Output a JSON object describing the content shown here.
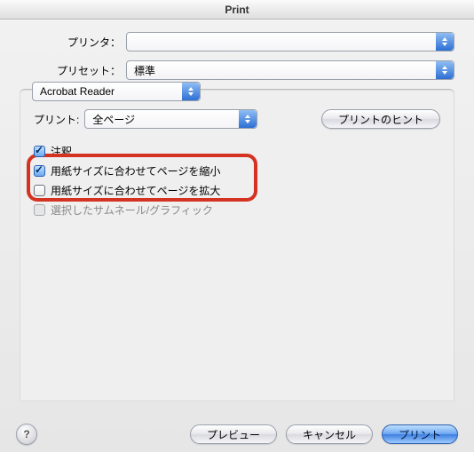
{
  "window": {
    "title": "Print"
  },
  "header": {
    "printer_label": "プリンタ：",
    "printer_value": "",
    "preset_label": "プリセット：",
    "preset_value": "標準"
  },
  "section_tab": "Acrobat Reader",
  "section": {
    "print_label": "プリント:",
    "print_value": "全ページ",
    "hints_button": "プリントのヒント"
  },
  "options": {
    "annot": {
      "label": "注釈",
      "checked": true,
      "enabled": true
    },
    "shrink": {
      "label": "用紙サイズに合わせてページを縮小",
      "checked": true,
      "enabled": true
    },
    "expand": {
      "label": "用紙サイズに合わせてページを拡大",
      "checked": false,
      "enabled": true
    },
    "thumb": {
      "label": "選択したサムネール/グラフィック",
      "checked": false,
      "enabled": false
    }
  },
  "highlight": {
    "description": "用紙サイズに合わせてページを縮小 オプションが赤枠で強調されている"
  },
  "footer": {
    "help": "?",
    "preview": "プレビュー",
    "cancel": "キャンセル",
    "print": "プリント"
  }
}
